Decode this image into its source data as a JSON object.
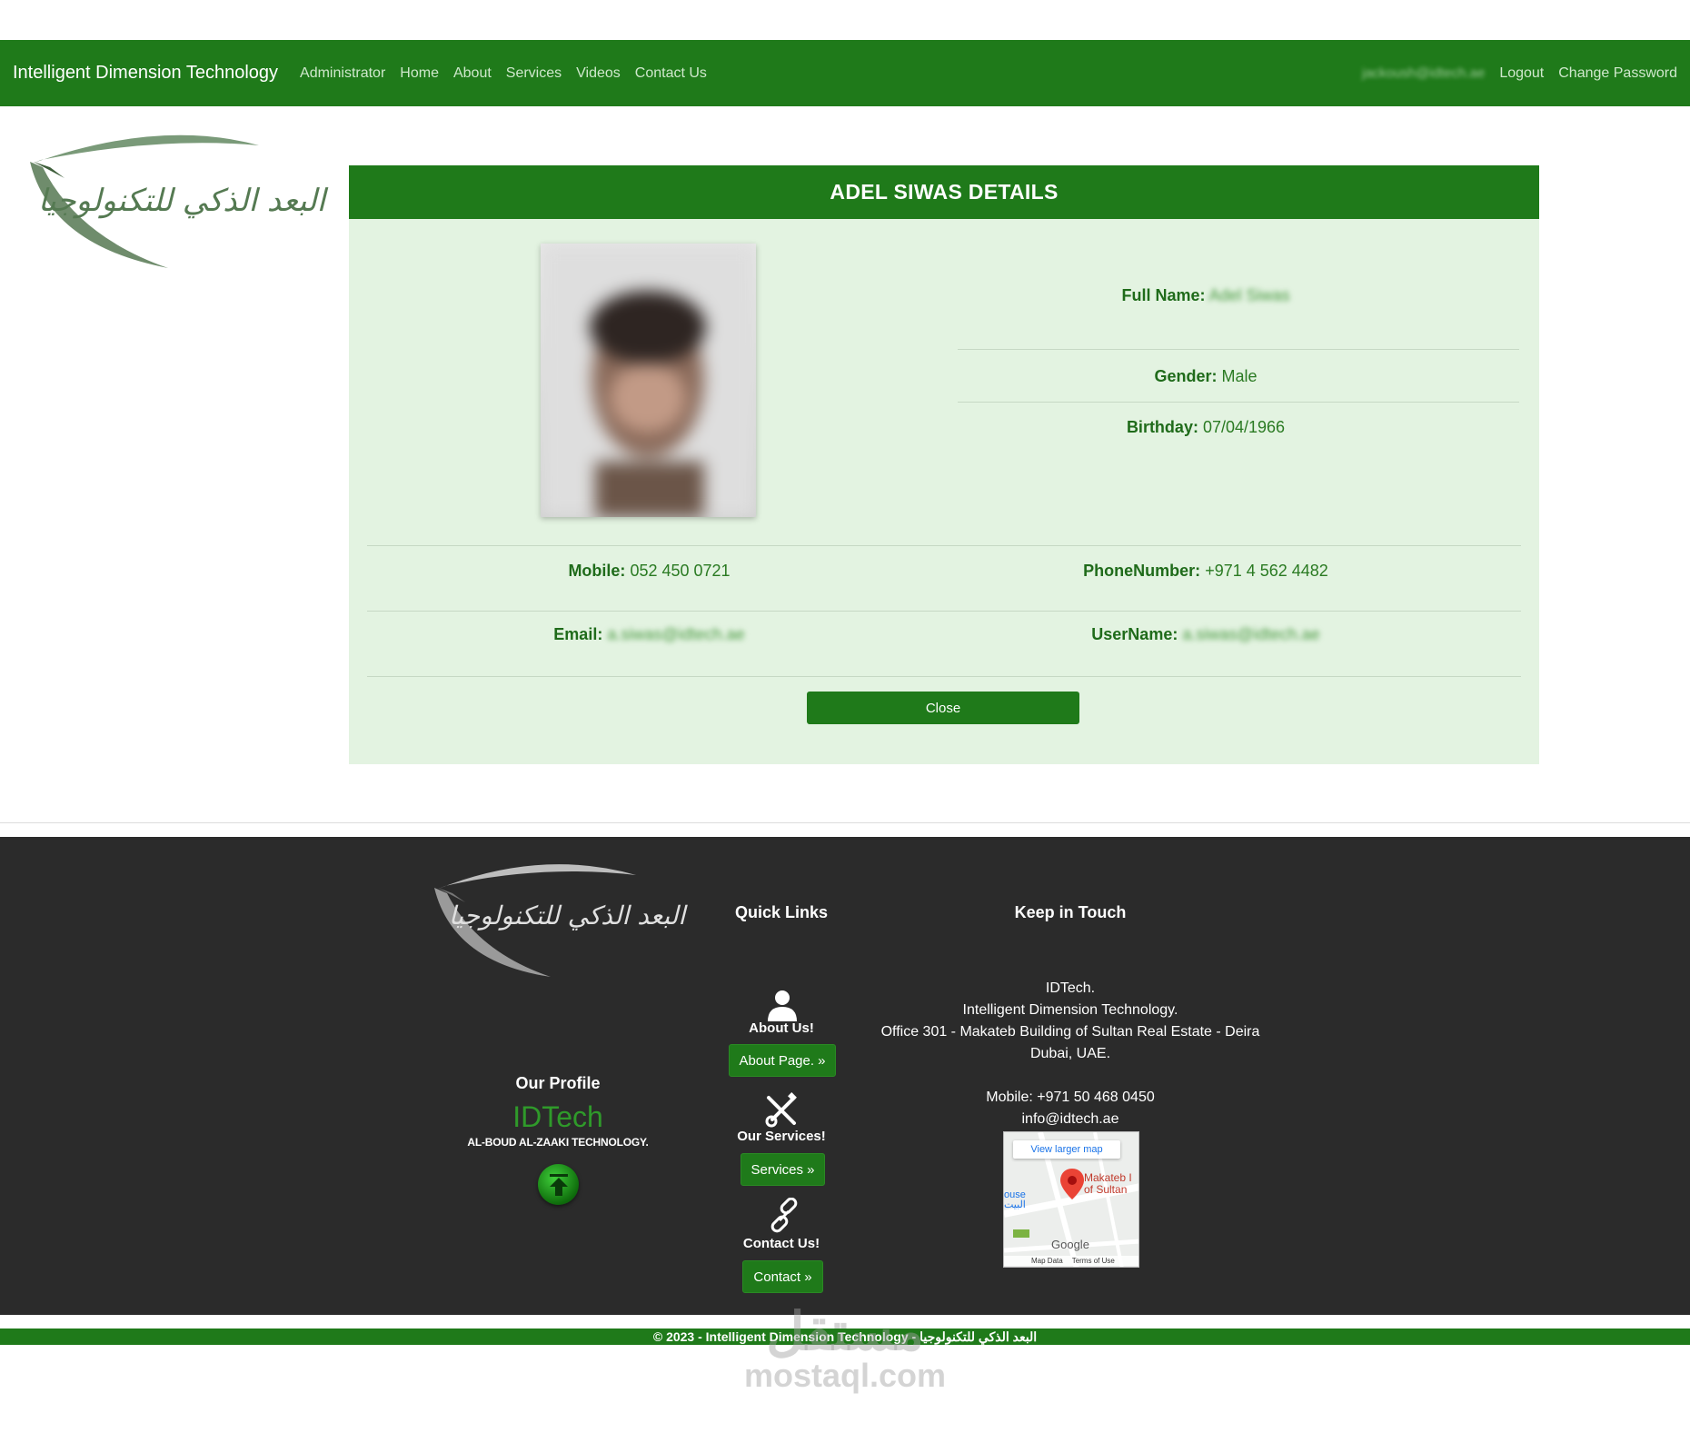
{
  "nav": {
    "brand": "Intelligent Dimension Technology",
    "links": [
      "Administrator",
      "Home",
      "About",
      "Services",
      "Videos",
      "Contact Us"
    ],
    "user_email": "jackoush@idtech.ae",
    "logout": "Logout",
    "change_password": "Change Password"
  },
  "logo": {
    "arabic": "البعد الذكي للتكنولوجيا"
  },
  "details": {
    "title": "ADEL SIWAS DETAILS",
    "full_name_label": "Full Name:",
    "full_name": "Adel Siwas",
    "gender_label": "Gender:",
    "gender": "Male",
    "birthday_label": "Birthday:",
    "birthday": "07/04/1966",
    "mobile_label": "Mobile:",
    "mobile": "052 450 0721",
    "phone_label": "PhoneNumber:",
    "phone": "+971 4 562 4482",
    "email_label": "Email:",
    "email": "a.siwas@idtech.ae",
    "username_label": "UserName:",
    "username": "a.siwas@idtech.ae",
    "close": "Close"
  },
  "footer": {
    "quick_links_title": "Quick Links",
    "keep_in_touch_title": "Keep in Touch",
    "profile_title": "Our Profile",
    "profile_brand": "IDTech",
    "profile_sub": "AL-BOUD AL-ZAAKI TECHNOLOGY.",
    "about_label": "About Us!",
    "about_btn": "About Page. »",
    "services_label": "Our Services!",
    "services_btn": "Services »",
    "contact_label": "Contact Us!",
    "contact_btn": "Contact »",
    "contact_lines": [
      "IDTech.",
      "Intelligent Dimension Technology.",
      "Office 301 - Makateb Building of Sultan Real Estate - Deira",
      "Dubai, UAE."
    ],
    "mobile_line": "Mobile:   +971 50 468 0450",
    "email_line": "info@idtech.ae",
    "map": {
      "view_larger": "View larger map",
      "place_1": "Makateb I",
      "place_2": "of Sultan",
      "house": "ouse",
      "house_ar": "البيت",
      "google": "Google",
      "map_data": "Map Data",
      "terms": "Terms of Use"
    },
    "copyright": "© 2023 - Intelligent Dimension Technology - البعد الذكي للتكنولوجيا"
  },
  "watermark": {
    "arabic": "مستقل",
    "latin": "mostaql.com"
  },
  "colors": {
    "primary_green": "#1f7a1a",
    "panel_bg": "#e3f3e1",
    "footer_bg": "#2b2b2b"
  }
}
